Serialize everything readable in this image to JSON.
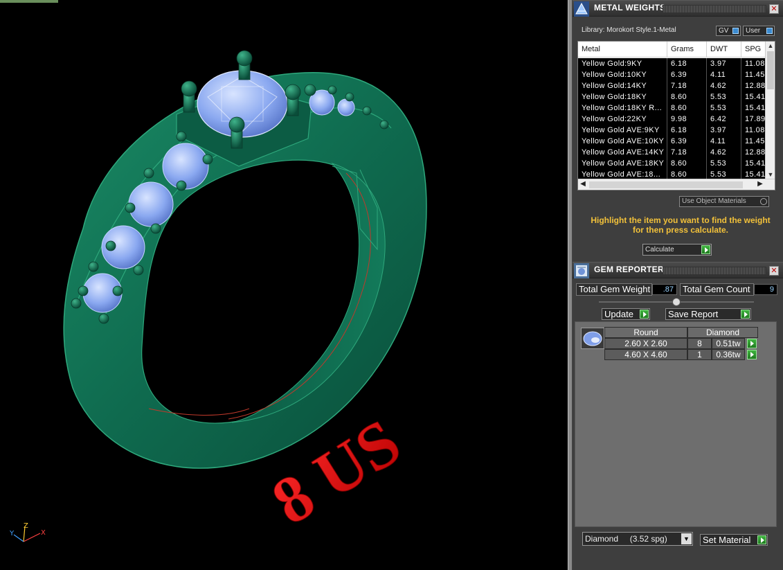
{
  "viewport": {
    "engraving": "8 US",
    "axis_labels": {
      "x": "X",
      "y": "Y",
      "z": "Z"
    }
  },
  "metal_weights": {
    "title": "METAL WEIGHTS",
    "library": "Library: Morokort Style.1-Metal",
    "gv_label": "GV",
    "user_label": "User",
    "columns": [
      "Metal",
      "Grams",
      "DWT",
      "SPG"
    ],
    "rows": [
      {
        "metal": "Yellow Gold:9KY",
        "grams": "6.18",
        "dwt": "3.97",
        "spg": "11.08"
      },
      {
        "metal": "Yellow Gold:10KY",
        "grams": "6.39",
        "dwt": "4.11",
        "spg": "11.45"
      },
      {
        "metal": "Yellow Gold:14KY",
        "grams": "7.18",
        "dwt": "4.62",
        "spg": "12.88"
      },
      {
        "metal": "Yellow Gold:18KY",
        "grams": "8.60",
        "dwt": "5.53",
        "spg": "15.41"
      },
      {
        "metal": "Yellow Gold:18KY R...",
        "grams": "8.60",
        "dwt": "5.53",
        "spg": "15.41"
      },
      {
        "metal": "Yellow Gold:22KY",
        "grams": "9.98",
        "dwt": "6.42",
        "spg": "17.89"
      },
      {
        "metal": "Yellow Gold AVE:9KY",
        "grams": "6.18",
        "dwt": "3.97",
        "spg": "11.08"
      },
      {
        "metal": "Yellow Gold AVE:10KY",
        "grams": "6.39",
        "dwt": "4.11",
        "spg": "11.45"
      },
      {
        "metal": "Yellow Gold AVE:14KY",
        "grams": "7.18",
        "dwt": "4.62",
        "spg": "12.88"
      },
      {
        "metal": "Yellow Gold AVE:18KY",
        "grams": "8.60",
        "dwt": "5.53",
        "spg": "15.41"
      },
      {
        "metal": "Yellow Gold AVE:18...",
        "grams": "8.60",
        "dwt": "5.53",
        "spg": "15.41"
      }
    ],
    "use_object_materials": "Use Object Materials",
    "hint_line1": "Highlight the item you want to find the weight",
    "hint_line2": "for then press calculate.",
    "calculate_label": "Calculate"
  },
  "gem_reporter": {
    "title": "GEM REPORTER",
    "total_weight_label": "Total Gem Weight",
    "total_weight_value": ".87",
    "total_count_label": "Total Gem Count",
    "total_count_value": "9",
    "update_label": "Update",
    "save_report_label": "Save Report",
    "table": {
      "shape": "Round",
      "material": "Diamond",
      "rows": [
        {
          "size": "2.60 X 2.60",
          "count": "8",
          "weight": "0.51tw"
        },
        {
          "size": "4.60 X 4.60",
          "count": "1",
          "weight": "0.36tw"
        }
      ]
    },
    "material_select": "Diamond     (3.52 spg)",
    "set_material_label": "Set Material"
  },
  "colors": {
    "ring": "#0f6b4f",
    "gem": "#8aa8f0",
    "engraving": "#e01515",
    "hint": "#f2c13a"
  }
}
